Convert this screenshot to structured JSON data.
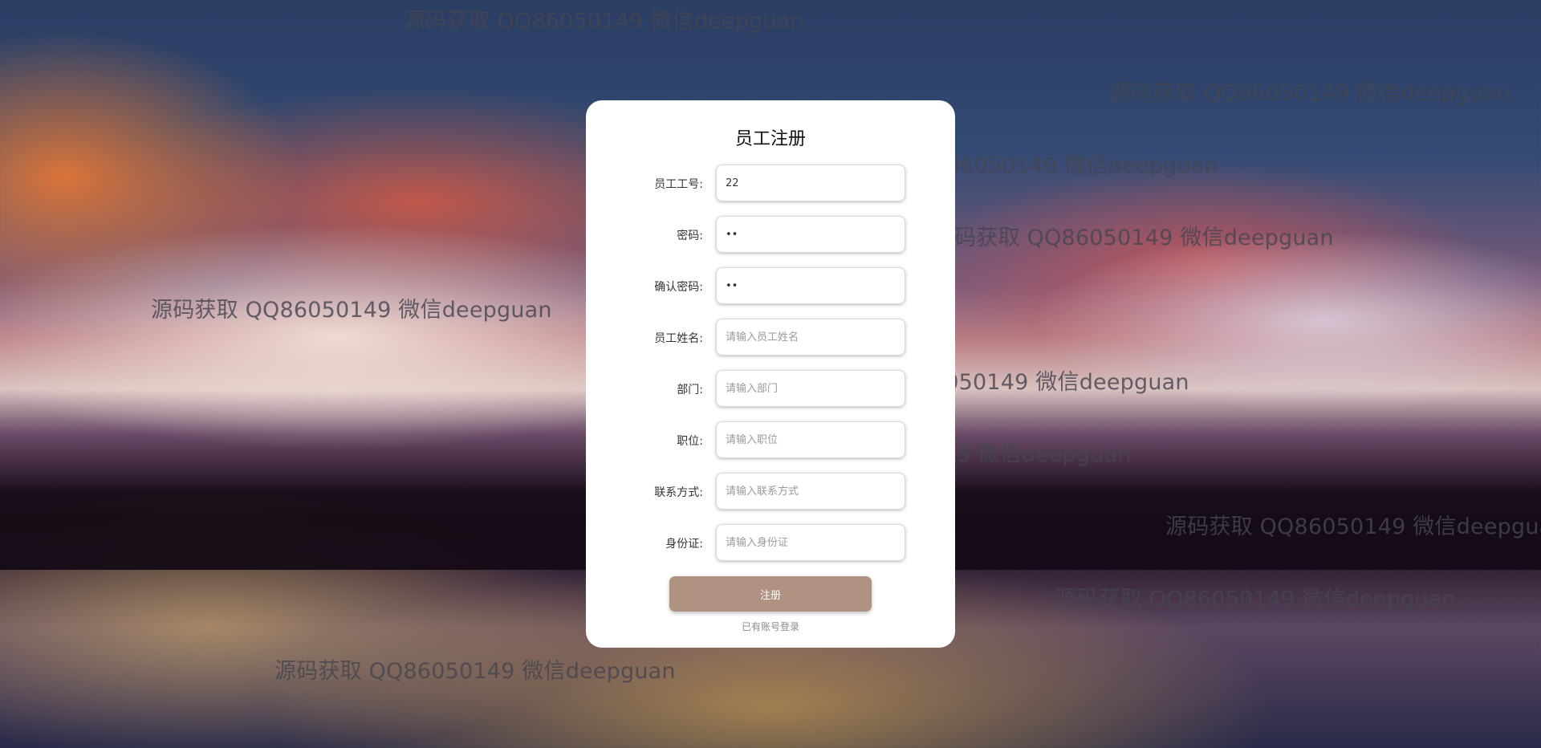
{
  "form": {
    "title": "员工注册",
    "fields": [
      {
        "label": "员工工号:",
        "value": "22",
        "placeholder": "",
        "type": "text"
      },
      {
        "label": "密码:",
        "value": "••",
        "placeholder": "",
        "type": "password"
      },
      {
        "label": "确认密码:",
        "value": "••",
        "placeholder": "",
        "type": "password"
      },
      {
        "label": "员工姓名:",
        "value": "",
        "placeholder": "请输入员工姓名",
        "type": "text"
      },
      {
        "label": "部门:",
        "value": "",
        "placeholder": "请输入部门",
        "type": "text"
      },
      {
        "label": "职位:",
        "value": "",
        "placeholder": "请输入职位",
        "type": "text"
      },
      {
        "label": "联系方式:",
        "value": "",
        "placeholder": "请输入联系方式",
        "type": "text"
      },
      {
        "label": "身份证:",
        "value": "",
        "placeholder": "请输入身份证",
        "type": "text"
      }
    ],
    "submit_label": "注册",
    "login_link": "已有账号登录",
    "colors": {
      "submit": "#b09282",
      "card": "#ffffff"
    }
  },
  "watermark": {
    "text": "源码获取 QQ86050149 微信deepguan"
  }
}
